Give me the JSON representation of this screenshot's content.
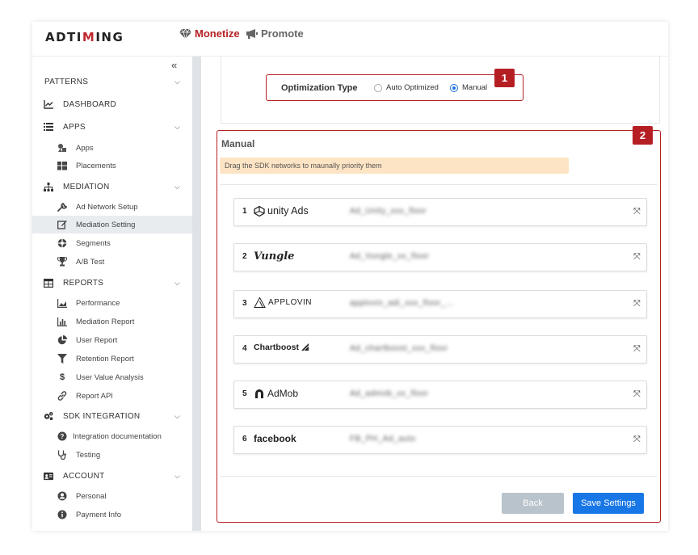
{
  "header": {
    "logo": {
      "part1": "ADTI",
      "part2": "M",
      "part3": "ING"
    },
    "tabs": [
      {
        "label": "Monetize",
        "icon": "diamond-icon",
        "active": true
      },
      {
        "label": "Promote",
        "icon": "megaphone-icon",
        "active": false
      }
    ]
  },
  "sidebar": {
    "collapse_glyph": "«",
    "items": [
      {
        "label": "PATTERNS",
        "type": "section"
      },
      {
        "label": "DASHBOARD",
        "type": "section",
        "icon": "chart-line-icon"
      },
      {
        "label": "APPS",
        "type": "section",
        "icon": "list-icon"
      },
      {
        "label": "Apps",
        "type": "sub",
        "icon": "shapes-icon"
      },
      {
        "label": "Placements",
        "type": "sub",
        "icon": "grid-icon"
      },
      {
        "label": "MEDIATION",
        "type": "section",
        "icon": "sitemap-icon"
      },
      {
        "label": "Ad Network Setup",
        "type": "sub",
        "icon": "wrench-icon"
      },
      {
        "label": "Mediation Setting",
        "type": "sub",
        "icon": "edit-icon",
        "active": true
      },
      {
        "label": "Segments",
        "type": "sub",
        "icon": "segments-icon"
      },
      {
        "label": "A/B Test",
        "type": "sub",
        "icon": "trophy-icon"
      },
      {
        "label": "REPORTS",
        "type": "section",
        "icon": "table-icon"
      },
      {
        "label": "Performance",
        "type": "sub",
        "icon": "area-chart-icon"
      },
      {
        "label": "Mediation Report",
        "type": "sub",
        "icon": "bar-chart-icon"
      },
      {
        "label": "User Report",
        "type": "sub",
        "icon": "pie-chart-icon"
      },
      {
        "label": "Retention Report",
        "type": "sub",
        "icon": "filter-icon"
      },
      {
        "label": "User Value Analysis",
        "type": "sub",
        "icon": "dollar-icon"
      },
      {
        "label": "Report API",
        "type": "sub",
        "icon": "link-icon"
      },
      {
        "label": "SDK INTEGRATION",
        "type": "section",
        "icon": "cogs-icon"
      },
      {
        "label": "Integration documentation",
        "type": "sub",
        "icon": "question-icon"
      },
      {
        "label": "Testing",
        "type": "sub",
        "icon": "stethoscope-icon"
      },
      {
        "label": "ACCOUNT",
        "type": "section",
        "icon": "id-card-icon"
      },
      {
        "label": "Personal",
        "type": "sub",
        "icon": "user-circle-icon"
      },
      {
        "label": "Payment Info",
        "type": "sub",
        "icon": "info-icon"
      }
    ]
  },
  "optimization": {
    "label": "Optimization Type",
    "options": [
      {
        "label": "Auto Optimized",
        "selected": false
      },
      {
        "label": "Manual",
        "selected": true
      }
    ],
    "callout": "1"
  },
  "manual": {
    "title": "Manual",
    "hint": "Drag the SDK networks to maunally priority them",
    "callout": "2",
    "networks": [
      {
        "rank": "1",
        "brand": "unity Ads",
        "name": "Ad_Unity_xxx_floor"
      },
      {
        "rank": "2",
        "brand": "Vungle",
        "name": "Ad_Vungle_xx_floor"
      },
      {
        "rank": "3",
        "brand": "APPLOVIN",
        "name": "applovin_adi_xxx_floor_..."
      },
      {
        "rank": "4",
        "brand": "Chartboost",
        "name": "Ad_chartboost_xxx_floor"
      },
      {
        "rank": "5",
        "brand": "AdMob",
        "name": "Ad_admob_xx_floor"
      },
      {
        "rank": "6",
        "brand": "facebook",
        "name": "FB_PH_Ad_auto"
      }
    ],
    "drag_glyph": "⤧",
    "back_label": "Back",
    "save_label": "Save Settings"
  },
  "colors": {
    "accent": "#b51f24",
    "primary_button": "#1877e6",
    "hint_bg": "#fde4c4"
  }
}
